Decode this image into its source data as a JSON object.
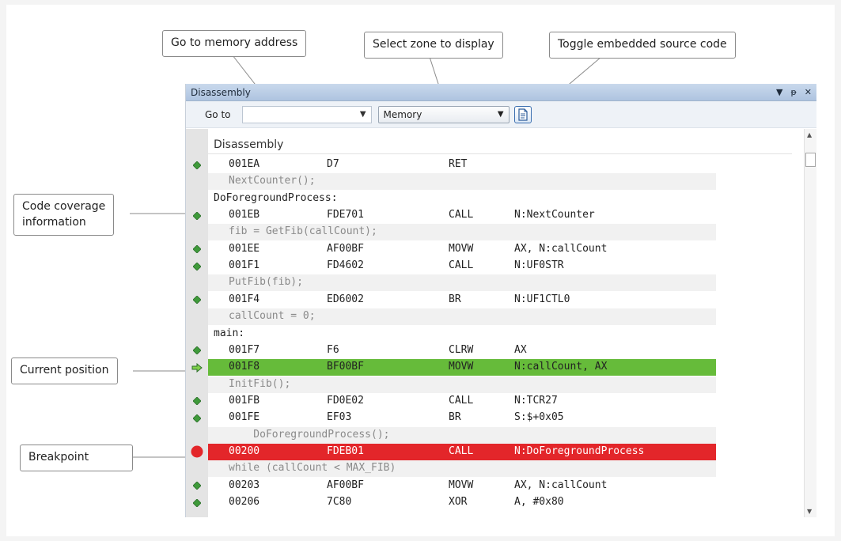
{
  "callouts": {
    "goto_memory": "Go to memory address",
    "select_zone": "Select zone to display",
    "toggle_source": "Toggle embedded source code",
    "code_coverage": "Code coverage\ninformation",
    "current_position": "Current position",
    "breakpoint": "Breakpoint"
  },
  "window": {
    "title": "Disassembly",
    "controls": [
      "▼",
      "ᵽ",
      "✕"
    ],
    "goto_label": "Go to",
    "goto_value": "",
    "zone_value": "Memory",
    "list_header": "Disassembly"
  },
  "colors": {
    "current_position": "#66bb3a",
    "breakpoint": "#e3262a",
    "coverage_marker": "#3f9a3a"
  },
  "rows": [
    {
      "kind": "instr",
      "marker": "coverage",
      "addr": "001EA",
      "code": "D7",
      "mnem": "RET",
      "ops": ""
    },
    {
      "kind": "src",
      "text": "NextCounter();"
    },
    {
      "kind": "label",
      "text": "DoForegroundProcess:"
    },
    {
      "kind": "instr",
      "marker": "coverage",
      "addr": "001EB",
      "code": "FDE701",
      "mnem": "CALL",
      "ops": "N:NextCounter"
    },
    {
      "kind": "src",
      "text": "fib = GetFib(callCount);"
    },
    {
      "kind": "instr",
      "marker": "coverage",
      "addr": "001EE",
      "code": "AF00BF",
      "mnem": "MOVW",
      "ops": "AX, N:callCount"
    },
    {
      "kind": "instr",
      "marker": "coverage",
      "addr": "001F1",
      "code": "FD4602",
      "mnem": "CALL",
      "ops": "N:UF0STR"
    },
    {
      "kind": "src",
      "text": "PutFib(fib);"
    },
    {
      "kind": "instr",
      "marker": "coverage",
      "addr": "001F4",
      "code": "ED6002",
      "mnem": "BR",
      "ops": "N:UF1CTL0"
    },
    {
      "kind": "src",
      "text": "callCount = 0;"
    },
    {
      "kind": "label",
      "text": "main:"
    },
    {
      "kind": "instr",
      "marker": "coverage",
      "addr": "001F7",
      "code": "F6",
      "mnem": "CLRW",
      "ops": "AX"
    },
    {
      "kind": "instr",
      "marker": "current",
      "addr": "001F8",
      "code": "BF00BF",
      "mnem": "MOVW",
      "ops": "N:callCount, AX"
    },
    {
      "kind": "src",
      "text": "InitFib();"
    },
    {
      "kind": "instr",
      "marker": "coverage",
      "addr": "001FB",
      "code": "FD0E02",
      "mnem": "CALL",
      "ops": "N:TCR27"
    },
    {
      "kind": "instr",
      "marker": "coverage",
      "addr": "001FE",
      "code": "EF03",
      "mnem": "BR",
      "ops": "S:$+0x05"
    },
    {
      "kind": "src",
      "text": "    DoForegroundProcess();"
    },
    {
      "kind": "instr",
      "marker": "breakpoint",
      "addr": "00200",
      "code": "FDEB01",
      "mnem": "CALL",
      "ops": "N:DoForegroundProcess"
    },
    {
      "kind": "src",
      "text": "while (callCount < MAX_FIB)"
    },
    {
      "kind": "instr",
      "marker": "coverage",
      "addr": "00203",
      "code": "AF00BF",
      "mnem": "MOVW",
      "ops": "AX, N:callCount"
    },
    {
      "kind": "instr",
      "marker": "coverage",
      "addr": "00206",
      "code": "7C80",
      "mnem": "XOR",
      "ops": "A, #0x80"
    }
  ]
}
